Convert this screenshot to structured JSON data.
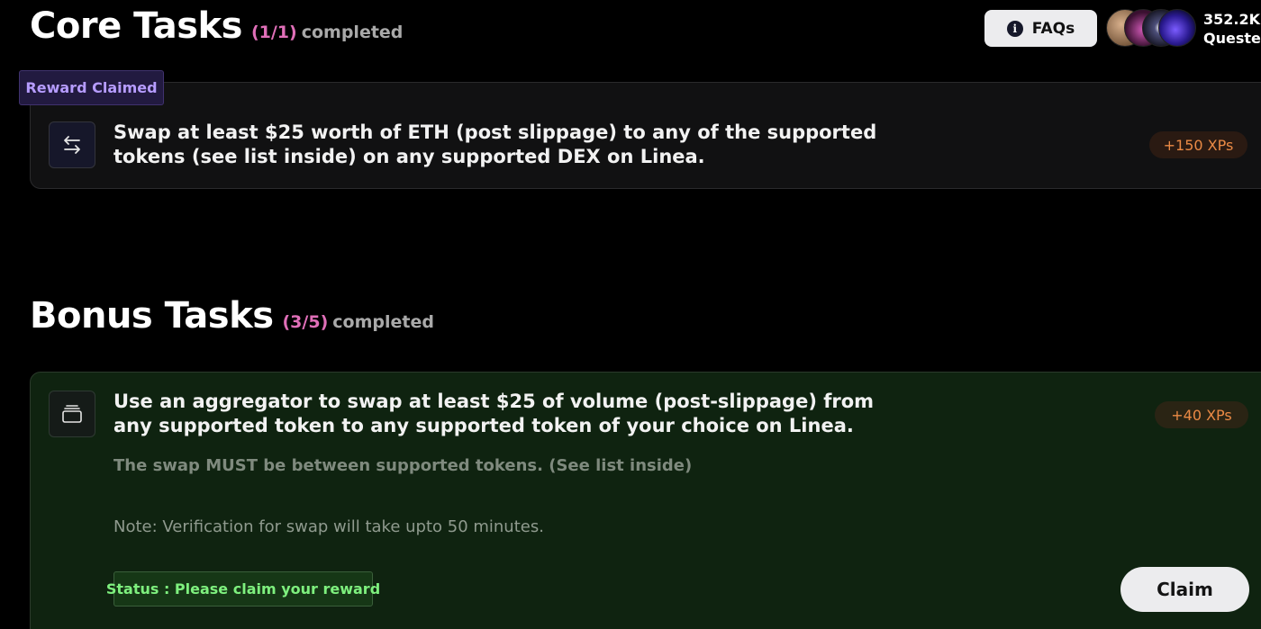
{
  "header": {
    "faq_label": "FAQs",
    "faq_icon": "info-icon",
    "questers_count": "352.2K",
    "questers_label": "Questers"
  },
  "core": {
    "title": "Core Tasks",
    "count": "(1/1)",
    "completed_label": "completed",
    "task": {
      "badge": "Reward Claimed",
      "icon": "swap-arrows-icon",
      "text": "Swap at least $25 worth of ETH (post slippage) to any of the supported tokens (see list inside) on any supported DEX on Linea.",
      "xp": "+150 XPs"
    }
  },
  "bonus": {
    "title": "Bonus Tasks",
    "count": "(3/5)",
    "completed_label": "completed",
    "task": {
      "icon": "wallet-icon",
      "text": "Use an aggregator to swap at least $25 of volume (post-slippage) from any supported token to any supported token of your choice on Linea.",
      "subtext": "The swap MUST be between supported tokens. (See list inside)",
      "note": "Note: Verification for swap will take upto 50 minutes.",
      "status": "Status : Please claim your reward",
      "xp": "+40 XPs",
      "claim_label": "Claim"
    }
  },
  "colors": {
    "background": "#000000",
    "count_pink": "#e06fb8",
    "xp_orange": "#ea8a45",
    "claimed_purple": "#b69cff",
    "status_green": "#7ef07e",
    "bonus_card_bg": "#0f2310"
  }
}
